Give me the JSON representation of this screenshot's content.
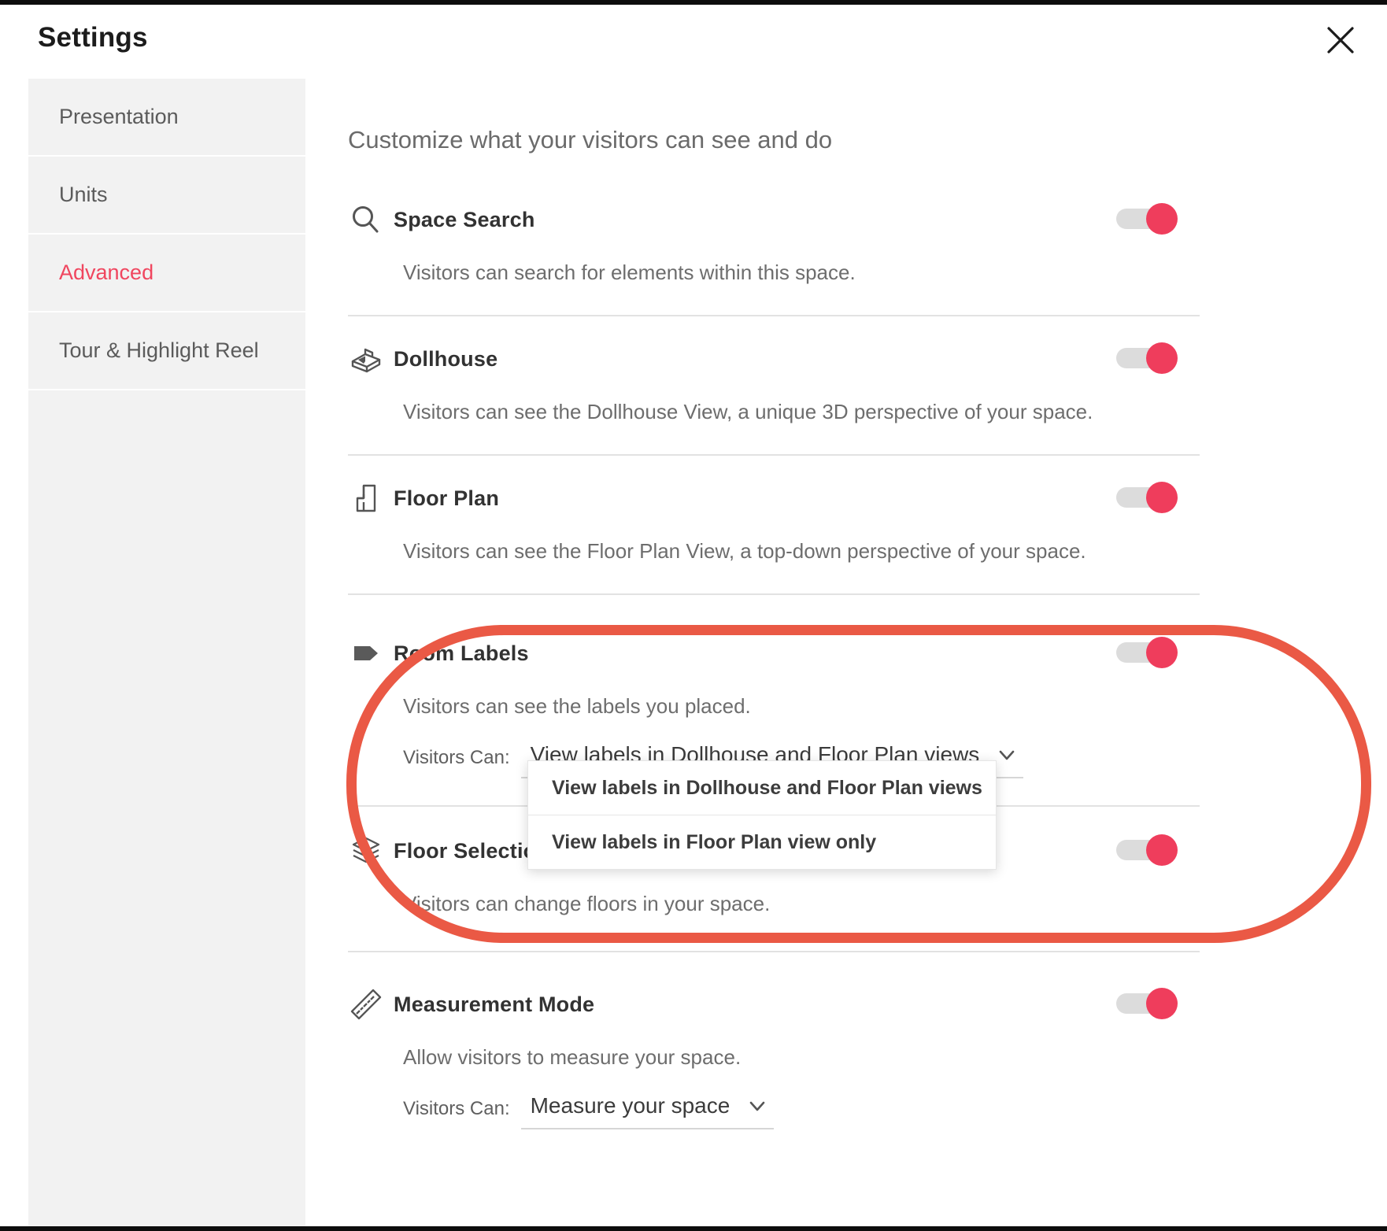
{
  "window": {
    "title": "Settings",
    "close_icon": "close-icon"
  },
  "sidebar": {
    "items": [
      {
        "label": "Presentation",
        "active": false
      },
      {
        "label": "Units",
        "active": false
      },
      {
        "label": "Advanced",
        "active": true
      },
      {
        "label": "Tour & Highlight Reel",
        "active": false
      }
    ]
  },
  "main": {
    "heading": "Customize what your visitors can see and do",
    "settings": [
      {
        "icon": "search-icon",
        "title": "Space Search",
        "description": "Visitors can search for elements within this space.",
        "toggle_on": true
      },
      {
        "icon": "dollhouse-icon",
        "title": "Dollhouse",
        "description": "Visitors can see the Dollhouse View, a unique 3D perspective of your space.",
        "toggle_on": true
      },
      {
        "icon": "floor-plan-icon",
        "title": "Floor Plan",
        "description": "Visitors can see the Floor Plan View, a top-down perspective of your space.",
        "toggle_on": true
      },
      {
        "icon": "room-label-tag-icon",
        "title": "Room Labels",
        "description": "Visitors can see the labels you placed.",
        "toggle_on": true,
        "select": {
          "label": "Visitors Can:",
          "value": "View labels in Dollhouse and Floor Plan views",
          "open": true,
          "options": [
            "View labels in Dollhouse and Floor Plan views",
            "View labels in Floor Plan view only"
          ]
        }
      },
      {
        "icon": "layers-icon",
        "title": "Floor Selection",
        "description": "Visitors can change floors in your space.",
        "toggle_on": true
      },
      {
        "icon": "ruler-icon",
        "title": "Measurement Mode",
        "description": "Allow visitors to measure your space.",
        "toggle_on": true,
        "select": {
          "label": "Visitors Can:",
          "value": "Measure your space",
          "open": false,
          "options": [
            "Measure your space"
          ]
        }
      }
    ]
  },
  "annotation": {
    "shape": "ellipse-highlight",
    "color": "#ea5945"
  },
  "colors": {
    "accent_red": "#f0465f",
    "toggle_on": "#ef3d5c",
    "toggle_track": "#dcdcdc",
    "sidebar_bg": "#f2f2f2",
    "annotation": "#ea5945",
    "title_text": "#1c1c1c",
    "body_text": "#6d6d6d"
  }
}
